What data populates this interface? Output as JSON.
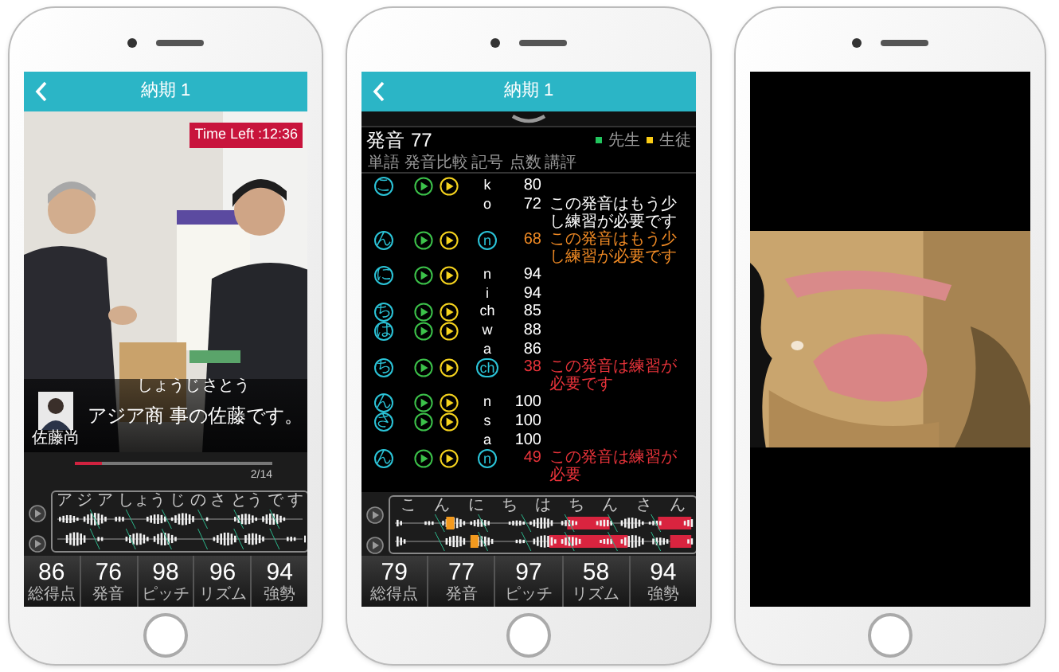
{
  "phones": [
    {
      "kind": "lesson",
      "header": {
        "title": "納期 1"
      },
      "timer": "Time Left :12:36",
      "speaker": {
        "name": "佐藤尚"
      },
      "subtitle": {
        "text": "アジア商 事の佐藤です。",
        "readings": [
          {
            "text": "しょうじ"
          },
          {
            "text": "さとう"
          }
        ]
      },
      "progress": {
        "level": 0.14,
        "label": "2/14"
      },
      "waveform": {
        "syllables": [
          "ア",
          "ジ",
          "ア",
          "しょう",
          "じ",
          "の",
          "さ",
          "とう",
          "で",
          "す"
        ]
      },
      "scores": [
        {
          "value": "86",
          "label": "総得点"
        },
        {
          "value": "76",
          "label": "発音"
        },
        {
          "value": "98",
          "label": "ピッチ"
        },
        {
          "value": "96",
          "label": "リズム"
        },
        {
          "value": "94",
          "label": "強勢"
        }
      ]
    },
    {
      "kind": "analysis",
      "header": {
        "title": "納期 1"
      },
      "section_title": "発音",
      "section_score": "77",
      "legend": [
        {
          "label": "先生",
          "color": "#22c55e"
        },
        {
          "label": "生徒",
          "color": "#facc15"
        }
      ],
      "columns": [
        "単語",
        "発音比較",
        "記号",
        "点数",
        "講評"
      ],
      "rows": [
        {
          "word": "こ",
          "symbol": "k",
          "circled": false,
          "score": "80",
          "color": "#ffffff"
        },
        {
          "symbol": "o",
          "circled": false,
          "score": "72",
          "color": "#ffffff",
          "comment": "この発音はもう少し練習が必要です"
        },
        {
          "word": "ん",
          "symbol": "n",
          "circled": true,
          "score": "68",
          "color": "#f08a24",
          "comment": "この発音はもう少し練習が必要です"
        },
        {
          "word": "に",
          "symbol": "n",
          "circled": false,
          "score": "94",
          "color": "#ffffff"
        },
        {
          "symbol": "i",
          "circled": false,
          "score": "94",
          "color": "#ffffff"
        },
        {
          "word": "ち",
          "symbol": "ch",
          "circled": false,
          "score": "85",
          "color": "#ffffff"
        },
        {
          "word": "は",
          "symbol": "w",
          "circled": false,
          "score": "88",
          "color": "#ffffff"
        },
        {
          "symbol": "a",
          "circled": false,
          "score": "86",
          "color": "#ffffff"
        },
        {
          "word": "ち",
          "symbol": "ch",
          "circled": true,
          "score": "38",
          "color": "#e8333a",
          "comment": "この発音は練習が必要です"
        },
        {
          "word": "ん",
          "symbol": "n",
          "circled": false,
          "score": "100",
          "color": "#ffffff"
        },
        {
          "word": "さ",
          "symbol": "s",
          "circled": false,
          "score": "100",
          "color": "#ffffff"
        },
        {
          "symbol": "a",
          "circled": false,
          "score": "100",
          "color": "#ffffff"
        },
        {
          "word": "ん",
          "symbol": "n",
          "circled": true,
          "score": "49",
          "color": "#e8333a",
          "comment": "この発音は練習が必要"
        }
      ],
      "waveform": {
        "syllables": [
          "こ",
          "ん",
          "に",
          "ち",
          "は",
          "ち",
          "ん",
          "さ",
          "ん"
        ]
      },
      "scores": [
        {
          "value": "79",
          "label": "総得点"
        },
        {
          "value": "77",
          "label": "発音"
        },
        {
          "value": "97",
          "label": "ピッチ"
        },
        {
          "value": "58",
          "label": "リズム"
        },
        {
          "value": "94",
          "label": "強勢"
        }
      ]
    },
    {
      "kind": "video"
    }
  ]
}
